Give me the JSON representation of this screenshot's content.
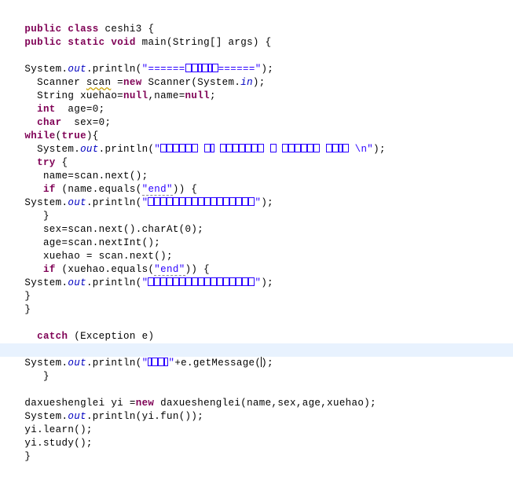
{
  "editor": {
    "app": "java-code-editor",
    "language": "Java",
    "class_name": "ceshi3",
    "colors": {
      "background": "#ffffff",
      "foreground": "#000000",
      "keyword": "#7f0055",
      "string": "#2a00ff",
      "field": "#0000c0",
      "current_line_highlight": "#e8f2fe",
      "warning_underline": "#c8a200"
    },
    "caret": {
      "visible": true,
      "line_index": 25,
      "inside": "e.getMessage()"
    },
    "lines": [
      {
        "id": 0,
        "text": "public class ceshi3 {"
      },
      {
        "id": 1,
        "text": "public static void main(String[] args) {"
      },
      {
        "id": 2,
        "text": ""
      },
      {
        "id": 3,
        "text": "System.out.println(\"======可以输入信息======\");"
      },
      {
        "id": 4,
        "text": "  Scanner scan =new Scanner(System.in);"
      },
      {
        "id": 5,
        "text": "  String xuehao=null,name=null;"
      },
      {
        "id": 6,
        "text": "  int  age=0;"
      },
      {
        "id": 7,
        "text": "  char  sex=0;"
      },
      {
        "id": 8,
        "text": "while(true){"
      },
      {
        "id": 9,
        "text": "  System.out.println(\"请输入姓名 性别 年龄 学号，退出请输入end \\n\");"
      },
      {
        "id": 10,
        "text": "  try {"
      },
      {
        "id": 11,
        "text": "   name=scan.next();"
      },
      {
        "id": 12,
        "text": "   if (name.equals(\"end\")) {"
      },
      {
        "id": 13,
        "text": "System.out.println(\"输入已结束，程序退出运行\");"
      },
      {
        "id": 14,
        "text": "   }"
      },
      {
        "id": 15,
        "text": "   sex=scan.next().charAt(0);"
      },
      {
        "id": 16,
        "text": "   age=scan.nextInt();"
      },
      {
        "id": 17,
        "text": "   xuehao = scan.next();"
      },
      {
        "id": 18,
        "text": "   if (xuehao.equals(\"end\")) {"
      },
      {
        "id": 19,
        "text": "System.out.println(\"输入已结束，程序退出运行\");"
      },
      {
        "id": 20,
        "text": "}"
      },
      {
        "id": 21,
        "text": "}"
      },
      {
        "id": 22,
        "text": ""
      },
      {
        "id": 23,
        "text": "  catch (Exception e)"
      },
      {
        "id": 24,
        "text": "  {"
      },
      {
        "id": 25,
        "text": "System.out.println(\"错误：\"+e.getMessage());"
      },
      {
        "id": 26,
        "text": "   }"
      },
      {
        "id": 27,
        "text": ""
      },
      {
        "id": 28,
        "text": "daxueshenglei yi =new daxueshenglei(name,sex,age,xuehao);"
      },
      {
        "id": 29,
        "text": "System.out.println(yi.fun());"
      },
      {
        "id": 30,
        "text": "yi.learn();"
      },
      {
        "id": 31,
        "text": "yi.study();"
      },
      {
        "id": 32,
        "text": "}"
      }
    ],
    "tokens": {
      "public": "public",
      "class": "class",
      "static": "static",
      "void": "void",
      "new": "new",
      "null": "null",
      "int": "int",
      "char": "char",
      "while": "while",
      "true": "true",
      "try": "try",
      "if": "if",
      "catch": "catch",
      "system": "System",
      "out": "out",
      "in": "in",
      "println": "println",
      "scanner": "Scanner",
      "scan": "scan",
      "string_type": "String",
      "main": "main",
      "args": "args",
      "string_array": "String[]",
      "exception": "Exception",
      "end_literal": "\"end\"",
      "daxueshenglei": "daxueshenglei",
      "yi": "yi"
    },
    "literals": {
      "equals_banner": "\"======可以输入信息======\"",
      "prompt": "\"请输入姓名 性别 年龄 学号，退出请输入end \\n\"",
      "exit_message": "\"输入已结束，程序退出运行\"",
      "error_prefix": "\"错误：\"",
      "end": "\"end\""
    },
    "segments": {
      "l0": {
        "a": "public",
        "b": " ",
        "c": "class",
        "d": " ceshi3 {"
      },
      "l1": {
        "a": "public",
        "b": " ",
        "c": "static",
        "d": " ",
        "e": "void",
        "f": " main(String[] args) {"
      },
      "l3": {
        "pre": "System.",
        "fld": "out",
        "mid": ".println(",
        "q1": "\"",
        "eq1": "======",
        "eq2": "======",
        "q2": "\"",
        "post": ");"
      },
      "l4": {
        "pre": "  Scanner ",
        "var": "scan",
        "mid": " =",
        "kw": "new",
        "post": " Scanner(System.",
        "fld": "in",
        "end": ");"
      },
      "l5": {
        "pre": "  String xuehao=",
        "k1": "null",
        "mid": ",name=",
        "k2": "null",
        "end": ";"
      },
      "l6": {
        "kw": "int",
        "rest": "  age=0;",
        "indent": "  "
      },
      "l7": {
        "kw": "char",
        "rest": "  sex=0;",
        "indent": "  "
      },
      "l8": {
        "kw": "while",
        "p1": "(",
        "kw2": "true",
        "p2": "){"
      },
      "l9": {
        "pre": "  System.",
        "fld": "out",
        "mid": ".println(",
        "q1": "\"",
        "tail": " \\n\"",
        "post": ");"
      },
      "l10": {
        "kw": "try",
        "rest": " {",
        "indent": "  "
      },
      "l11": {
        "text": "   name=scan.next();"
      },
      "l12": {
        "indent": "   ",
        "kw": "if",
        "mid": " (name.equals(",
        "str": "\"end\"",
        "post": ")) {"
      },
      "l13": {
        "pre": "System.",
        "fld": "out",
        "mid": ".println(",
        "q1": "\"",
        "q2": "\"",
        "post": ");"
      },
      "l14": {
        "text": "   }"
      },
      "l15": {
        "text": "   sex=scan.next().charAt(0);"
      },
      "l16": {
        "text": "   age=scan.nextInt();"
      },
      "l17": {
        "text": "   xuehao = scan.next();"
      },
      "l18": {
        "indent": "   ",
        "kw": "if",
        "mid": " (xuehao.equals(",
        "str": "\"end\"",
        "post": ")) {"
      },
      "l19": {
        "pre": "System.",
        "fld": "out",
        "mid": ".println(",
        "q1": "\"",
        "q2": "\"",
        "post": ");"
      },
      "l20": {
        "text": "}"
      },
      "l21": {
        "text": "}"
      },
      "l23": {
        "indent": "  ",
        "kw": "catch",
        "rest": " (Exception e)"
      },
      "l24": {
        "text": "  {"
      },
      "l25": {
        "pre": "System.",
        "fld": "out",
        "mid": ".println(",
        "q1": "\"",
        "q2": "\"",
        "plus": "+e.getMessage(",
        "close": ");"
      },
      "l26": {
        "text": "   }"
      },
      "l28": {
        "pre": "daxueshenglei yi =",
        "kw": "new",
        "post": " daxueshenglei(name,sex,age,xuehao);"
      },
      "l29": {
        "pre": "System.",
        "fld": "out",
        "mid": ".println(yi.fun());"
      },
      "l30": {
        "text": "yi.learn();"
      },
      "l31": {
        "text": "yi.study();"
      },
      "l32": {
        "text": "}"
      }
    }
  }
}
